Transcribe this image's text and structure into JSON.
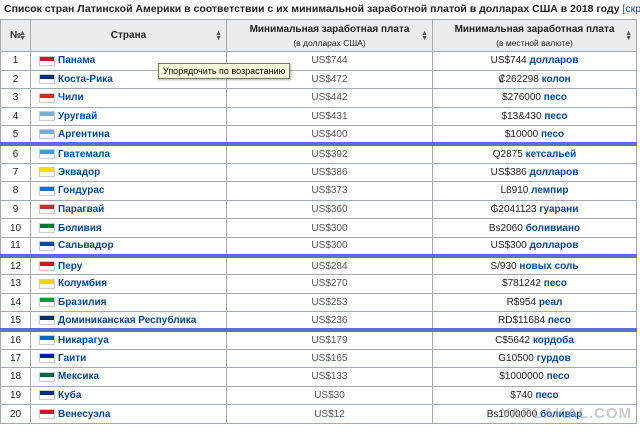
{
  "caption": {
    "title": "Список стран Латинской Америки в соответствии с их минимальной заработной платой в долларах США в 2018 году",
    "hide_link": "[скрыть]"
  },
  "headers": {
    "num": "№",
    "country": "Страна",
    "usd": "Минимальная заработная плата",
    "usd_sub": "(в долларах США)",
    "local": "Минимальная заработная плата",
    "local_sub": "(в местной валюте)"
  },
  "tooltip": "Упорядочить по возрастанию",
  "watermark": "YAPLAKAL.COM",
  "rows": [
    {
      "num": "1",
      "country": "Панама",
      "usd": "US$744",
      "local_amount": "US$744",
      "local_cur": "долларов",
      "sep": false
    },
    {
      "num": "2",
      "country": "Коста-Рика",
      "usd": "US$472",
      "local_amount": "₡262298",
      "local_cur": "колон",
      "sep": false
    },
    {
      "num": "3",
      "country": "Чили",
      "usd": "US$442",
      "local_amount": "$276000",
      "local_cur": "песо",
      "sep": false
    },
    {
      "num": "4",
      "country": "Уругвай",
      "usd": "US$431",
      "local_amount": "$13&430",
      "local_cur": "песо",
      "sep": false
    },
    {
      "num": "5",
      "country": "Аргентина",
      "usd": "US$400",
      "local_amount": "$10000",
      "local_cur": "песо",
      "sep": false
    },
    {
      "num": "6",
      "country": "Гватемала",
      "usd": "US$392",
      "local_amount": "Q2875",
      "local_cur": "кетсальей",
      "sep": true
    },
    {
      "num": "7",
      "country": "Эквадор",
      "usd": "US$386",
      "local_amount": "US$386",
      "local_cur": "долларов",
      "sep": false
    },
    {
      "num": "8",
      "country": "Гондурас",
      "usd": "US$373",
      "local_amount": "L8910",
      "local_cur": "лемпир",
      "sep": false
    },
    {
      "num": "9",
      "country": "Парагвай",
      "usd": "US$360",
      "local_amount": "₲2041123",
      "local_cur": "гуарани",
      "sep": false
    },
    {
      "num": "10",
      "country": "Боливия",
      "usd": "US$300",
      "local_amount": "Bs2060",
      "local_cur": "боливиано",
      "sep": false
    },
    {
      "num": "11",
      "country": "Сальвадор",
      "usd": "US$300",
      "local_amount": "US$300",
      "local_cur": "долларов",
      "sep": false
    },
    {
      "num": "12",
      "country": "Перу",
      "usd": "US$284",
      "local_amount": "S/930",
      "local_cur": "новых соль",
      "sep": true
    },
    {
      "num": "13",
      "country": "Колумбия",
      "usd": "US$270",
      "local_amount": "$781242",
      "local_cur": "песо",
      "sep": false
    },
    {
      "num": "14",
      "country": "Бразилия",
      "usd": "US$253",
      "local_amount": "R$954",
      "local_cur": "реал",
      "sep": false
    },
    {
      "num": "15",
      "country": "Доминиканская Республика",
      "usd": "US$236",
      "local_amount": "RD$11684",
      "local_cur": "песо",
      "sep": false
    },
    {
      "num": "16",
      "country": "Никарагуа",
      "usd": "US$179",
      "local_amount": "C$5642",
      "local_cur": "кордоба",
      "sep": true
    },
    {
      "num": "17",
      "country": "Гаити",
      "usd": "US$165",
      "local_amount": "G10500",
      "local_cur": "гурдов",
      "sep": false
    },
    {
      "num": "18",
      "country": "Мексика",
      "usd": "US$133",
      "local_amount": "$1000000",
      "local_cur": "песо",
      "sep": false
    },
    {
      "num": "19",
      "country": "Куба",
      "usd": "US$30",
      "local_amount": "$740",
      "local_cur": "песо",
      "sep": false
    },
    {
      "num": "20",
      "country": "Венесуэла",
      "usd": "US$12",
      "local_amount": "Bs1000000",
      "local_cur": "боливар",
      "sep": false
    }
  ],
  "flag_colors": {
    "1": "#d21034",
    "2": "#002b7f",
    "3": "#d52b1e",
    "4": "#7bafd4",
    "5": "#74acdf",
    "6": "#4997d0",
    "7": "#ffdd00",
    "8": "#0073cf",
    "9": "#d52b1e",
    "10": "#007934",
    "11": "#0047ab",
    "12": "#d91023",
    "13": "#fcd116",
    "14": "#009c3b",
    "15": "#002d62",
    "16": "#0067c6",
    "17": "#00209f",
    "18": "#006847",
    "19": "#002a8f",
    "20": "#cf142b"
  }
}
